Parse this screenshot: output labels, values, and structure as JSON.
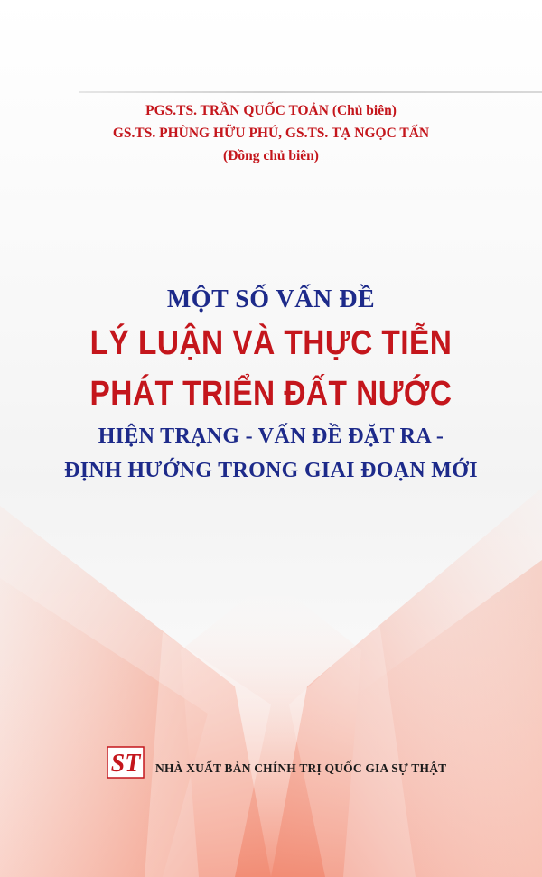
{
  "authors": {
    "line1": "PGS.TS. TRẦN QUỐC TOẢN (Chủ biên)",
    "line2": "GS.TS. PHÙNG HỮU PHÚ, GS.TS. TẠ NGỌC TẤN",
    "line3": "(Đồng chủ biên)"
  },
  "title": {
    "top": "MỘT SỐ VẤN ĐỀ",
    "main1": "LÝ LUẬN VÀ THỰC TIỄN",
    "main2": "PHÁT TRIỂN ĐẤT NƯỚC",
    "sub1": "HIỆN TRẠNG - VẤN ĐỀ ĐẶT RA -",
    "sub2": "ĐỊNH HƯỚNG TRONG GIAI ĐOẠN MỚI"
  },
  "publisher": {
    "logo_text": "ST",
    "name": "NHÀ XUẤT BẢN CHÍNH TRỊ QUỐC GIA SỰ THẬT"
  },
  "colors": {
    "red": "#c4161c",
    "blue": "#1d2a8a",
    "background": "#ffffff"
  }
}
